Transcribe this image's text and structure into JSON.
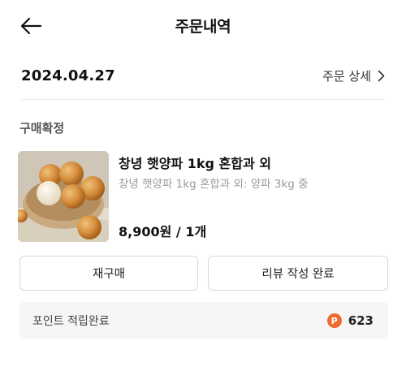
{
  "header": {
    "title": "주문내역",
    "back_icon": "arrow-left-icon"
  },
  "order": {
    "date": "2024.04.27",
    "detail_label": "주문 상세"
  },
  "status": "구매확정",
  "product": {
    "name": "창녕 햇양파 1kg 혼합과 외",
    "option": "창녕 햇양파 1kg 혼합과 외: 양파 3kg 중",
    "price": "8,900원 / 1개",
    "thumbnail": "onion-basket-image"
  },
  "buttons": {
    "rebuy": "재구매",
    "review": "리뷰 작성 완료"
  },
  "points": {
    "label": "포인트 적립완료",
    "badge": "P",
    "value": "623",
    "badge_color": "#ef6a2c"
  }
}
